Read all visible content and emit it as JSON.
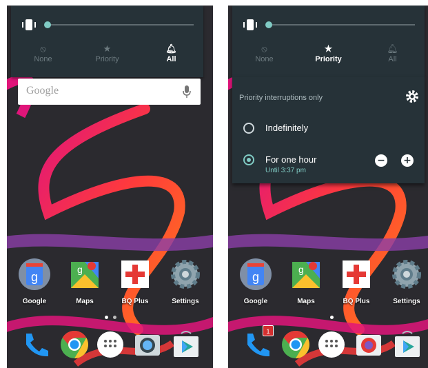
{
  "left_screen": {
    "modes": [
      {
        "label": "None",
        "icon": "block-icon",
        "active": false
      },
      {
        "label": "Priority",
        "icon": "star-icon",
        "active": false
      },
      {
        "label": "All",
        "icon": "bell-icon",
        "active": true
      }
    ],
    "search": {
      "placeholder": "Google"
    },
    "apps": [
      {
        "label": "Google",
        "icon": "google-app-icon"
      },
      {
        "label": "Maps",
        "icon": "maps-icon"
      },
      {
        "label": "BQ Plus",
        "icon": "bq-plus-icon"
      },
      {
        "label": "Settings",
        "icon": "settings-icon"
      }
    ],
    "dock": [
      "phone-icon",
      "chrome-icon",
      "app-drawer-icon",
      "camera-icon",
      "play-store-icon"
    ]
  },
  "right_screen": {
    "modes": [
      {
        "label": "None",
        "icon": "block-icon",
        "active": false
      },
      {
        "label": "Priority",
        "icon": "star-icon",
        "active": true
      },
      {
        "label": "All",
        "icon": "bell-icon",
        "active": false
      }
    ],
    "priority_panel": {
      "title": "Priority interruptions only",
      "options": [
        {
          "label": "Indefinitely",
          "selected": false
        },
        {
          "label": "For one hour",
          "sublabel": "Until 3:37 pm",
          "selected": true
        }
      ]
    },
    "apps": [
      {
        "label": "Google",
        "icon": "google-app-icon"
      },
      {
        "label": "Maps",
        "icon": "maps-icon"
      },
      {
        "label": "BQ Plus",
        "icon": "bq-plus-icon"
      },
      {
        "label": "Settings",
        "icon": "settings-icon"
      }
    ],
    "dock": [
      "phone-icon",
      "chrome-icon",
      "app-drawer-icon",
      "camera-icon",
      "play-store-icon"
    ],
    "phone_badge": "1"
  },
  "colors": {
    "panel_bg": "#263238",
    "accent": "#80cbc4",
    "wallpaper_bg": "#2b2a2f",
    "brush_red": "#ff3b3b",
    "brush_orange": "#ff7a1a",
    "brush_magenta": "#e0157a",
    "brush_purple": "#8b3fa8"
  }
}
